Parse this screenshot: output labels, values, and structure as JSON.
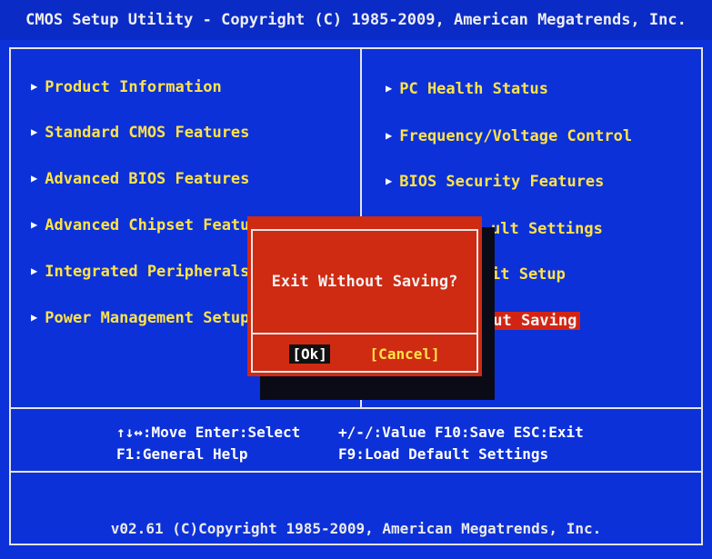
{
  "title": "CMOS Setup Utility - Copyright (C) 1985-2009, American Megatrends, Inc.",
  "left_menu": [
    {
      "label": "Product Information"
    },
    {
      "label": "Standard CMOS Features"
    },
    {
      "label": "Advanced BIOS Features"
    },
    {
      "label": "Advanced Chipset Featu"
    },
    {
      "label": "Integrated Peripherals"
    },
    {
      "label": "Power Management Setup"
    }
  ],
  "right_menu": [
    {
      "label": "PC Health Status"
    },
    {
      "label": "Frequency/Voltage Control"
    },
    {
      "label": "BIOS Security Features"
    },
    {
      "label": "ult Settings"
    },
    {
      "label": "it Setup"
    },
    {
      "label": "out Saving"
    }
  ],
  "arrow_glyph": "▶",
  "dialog": {
    "message": "Exit Without Saving?",
    "ok": "[Ok]",
    "cancel": "[Cancel]"
  },
  "help": {
    "line1a": "↑↓↔:Move  Enter:Select",
    "line1b": "+/-/:Value  F10:Save  ESC:Exit",
    "line2a": "F1:General Help",
    "line2b": "F9:Load Default Settings"
  },
  "copyright": "v02.61 (C)Copyright 1985-2009, American Megatrends, Inc.",
  "colors": {
    "background": "#0c31d8",
    "menu_text": "#ffe34a",
    "dialog": "#cf2a12",
    "highlight": "#d22414"
  }
}
